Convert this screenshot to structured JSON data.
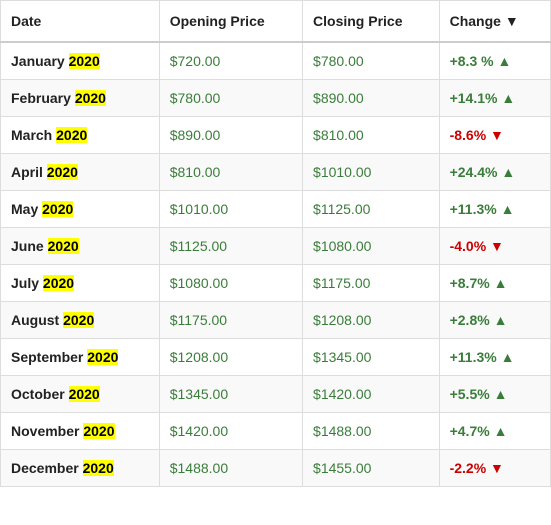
{
  "table": {
    "headers": [
      {
        "label": "Date",
        "key": "date"
      },
      {
        "label": "Opening Price",
        "key": "opening"
      },
      {
        "label": "Closing Price",
        "key": "closing"
      },
      {
        "label": "Change",
        "key": "change",
        "sortable": true
      }
    ],
    "rows": [
      {
        "month": "January",
        "year": "2020",
        "opening": "$720.00",
        "closing": "$780.00",
        "change": "+8.3 %",
        "positive": true
      },
      {
        "month": "February",
        "year": "2020",
        "opening": "$780.00",
        "closing": "$890.00",
        "change": "+14.1%",
        "positive": true
      },
      {
        "month": "March",
        "year": "2020",
        "opening": "$890.00",
        "closing": "$810.00",
        "change": "-8.6%",
        "positive": false
      },
      {
        "month": "April",
        "year": "2020",
        "opening": "$810.00",
        "closing": "$1010.00",
        "change": "+24.4%",
        "positive": true
      },
      {
        "month": "May",
        "year": "2020",
        "opening": "$1010.00",
        "closing": "$1125.00",
        "change": "+11.3%",
        "positive": true
      },
      {
        "month": "June",
        "year": "2020",
        "opening": "$1125.00",
        "closing": "$1080.00",
        "change": "-4.0%",
        "positive": false
      },
      {
        "month": "July",
        "year": "2020",
        "opening": "$1080.00",
        "closing": "$1175.00",
        "change": "+8.7%",
        "positive": true
      },
      {
        "month": "August",
        "year": "2020",
        "opening": "$1175.00",
        "closing": "$1208.00",
        "change": "+2.8%",
        "positive": true
      },
      {
        "month": "September",
        "year": "2020",
        "opening": "$1208.00",
        "closing": "$1345.00",
        "change": "+11.3%",
        "positive": true
      },
      {
        "month": "October",
        "year": "2020",
        "opening": "$1345.00",
        "closing": "$1420.00",
        "change": "+5.5%",
        "positive": true
      },
      {
        "month": "November",
        "year": "2020",
        "opening": "$1420.00",
        "closing": "$1488.00",
        "change": "+4.7%",
        "positive": true
      },
      {
        "month": "December",
        "year": "2020",
        "opening": "$1488.00",
        "closing": "$1455.00",
        "change": "-2.2%",
        "positive": false
      }
    ]
  }
}
